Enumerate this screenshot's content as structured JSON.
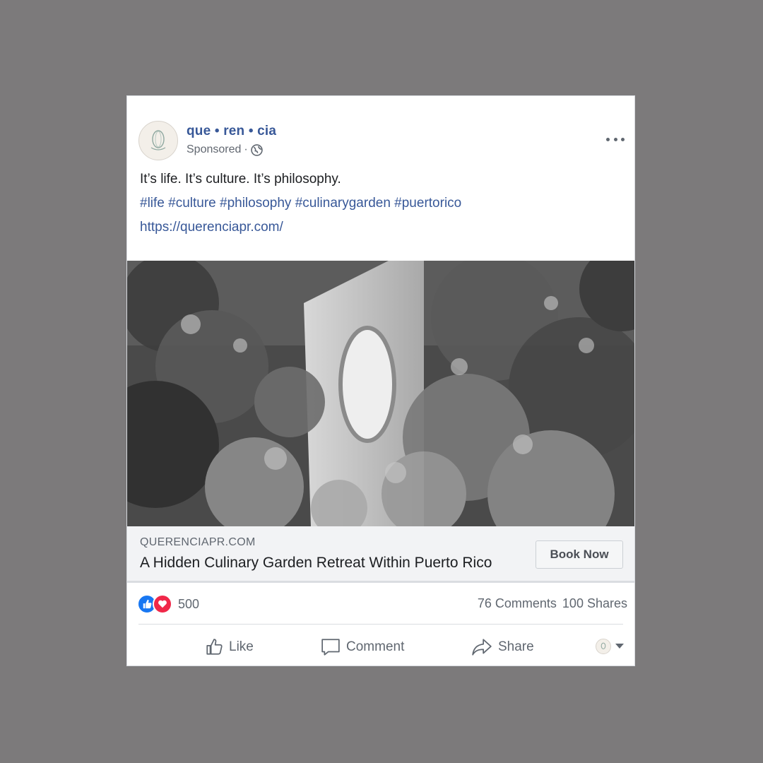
{
  "post": {
    "page_name": "que • ren • cia",
    "sponsored_label": "Sponsored",
    "separator": "·",
    "privacy_icon": "globe-icon",
    "text_line": "It’s life. It’s culture. It’s philosophy.",
    "hashtags": "#life #culture #philosophy #culinarygarden #puertorico",
    "url": "https://querenciapr.com/"
  },
  "link_preview": {
    "domain": "QUERENCIAPR.COM",
    "headline": "A Hidden Culinary Garden Retreat Within Puerto Rico",
    "cta_label": "Book Now"
  },
  "stats": {
    "reaction_count": "500",
    "reaction_icons": [
      "like-reaction-icon",
      "love-reaction-icon"
    ],
    "comments": "76 Comments",
    "shares": "100 Shares"
  },
  "actions": {
    "like_label": "Like",
    "comment_label": "Comment",
    "share_label": "Share"
  },
  "colors": {
    "background": "#7c7a7b",
    "link": "#385898",
    "like_blue": "#1877f2",
    "love_red": "#f02849"
  }
}
